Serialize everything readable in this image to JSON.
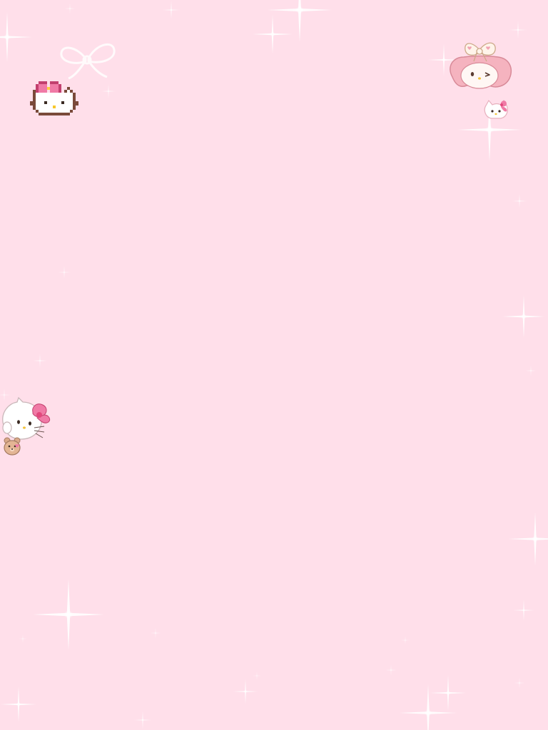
{
  "wallpaper": {
    "background_color": "#ffdfea",
    "sparkle_color": "#ffffff",
    "stickers": [
      {
        "name": "pixel-hello-kitty-face-icon"
      },
      {
        "name": "white-bow-outline-icon"
      },
      {
        "name": "my-melody-head-icon"
      },
      {
        "name": "small-hello-kitty-face-icon"
      },
      {
        "name": "hello-kitty-with-teddy-bear-icon"
      }
    ]
  }
}
